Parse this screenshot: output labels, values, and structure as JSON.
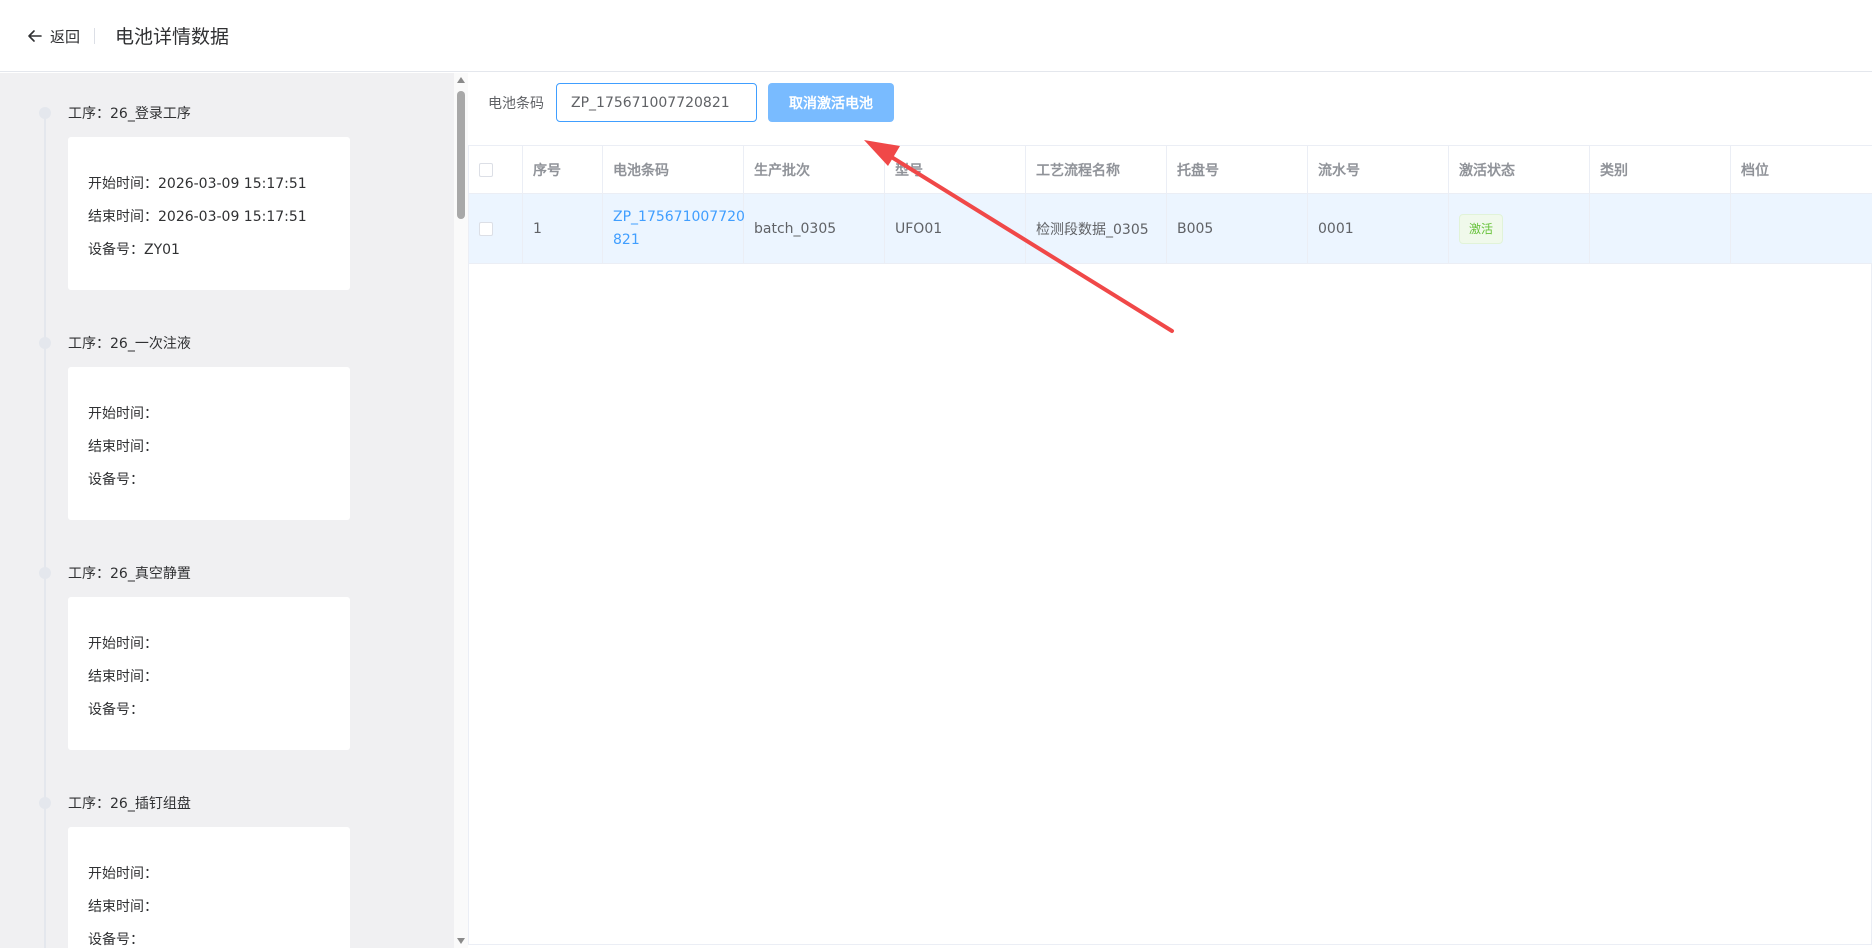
{
  "header": {
    "back_label": "返回",
    "title": "电池详情数据"
  },
  "steps": [
    {
      "name": "工序：26_登录工序",
      "start": "开始时间：2026-03-09 15:17:51",
      "end": "结束时间：2026-03-09 15:17:51",
      "device": "设备号：ZY01"
    },
    {
      "name": "工序：26_一次注液",
      "start": "开始时间：",
      "end": "结束时间：",
      "device": "设备号："
    },
    {
      "name": "工序：26_真空静置",
      "start": "开始时间：",
      "end": "结束时间：",
      "device": "设备号："
    },
    {
      "name": "工序：26_插钉组盘",
      "start": "开始时间：",
      "end": "结束时间：",
      "device": "设备号："
    }
  ],
  "search": {
    "label": "电池条码",
    "value": "ZP_175671007720821",
    "button_label": "取消激活电池"
  },
  "table": {
    "columns": [
      "序号",
      "电池条码",
      "生产批次",
      "型号",
      "工艺流程名称",
      "托盘号",
      "流水号",
      "激活状态",
      "类别",
      "档位"
    ],
    "rows": [
      {
        "index": "1",
        "barcode_line1": "ZP_175671007720",
        "barcode_line2": "821",
        "batch": "batch_0305",
        "model": "UFO01",
        "process": "检测段数据_0305",
        "tray": "B005",
        "serial": "0001",
        "status": "激活",
        "category": "",
        "grade": ""
      }
    ]
  },
  "colors": {
    "accent": "#409eff",
    "button": "#79bbff",
    "row_highlight": "#ecf5ff",
    "status_green": "#67c23a",
    "annotation_arrow": "#f04848"
  }
}
